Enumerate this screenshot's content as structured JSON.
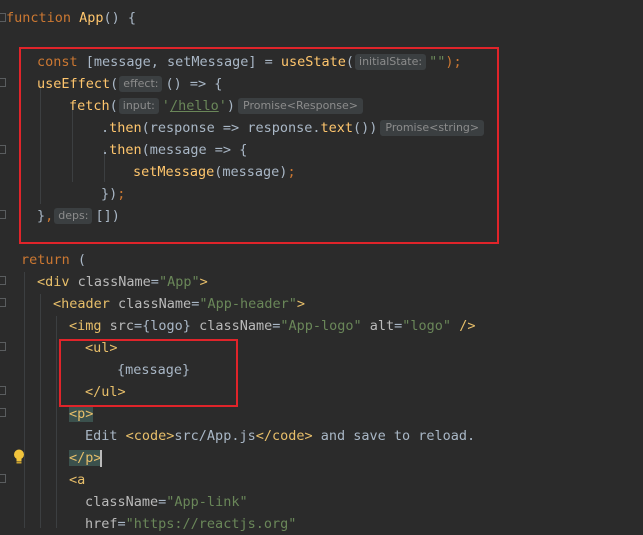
{
  "lines": {
    "l1": {
      "t1": "function",
      "t2": " App",
      "t3": "() {"
    },
    "l2": {
      "t1": "const",
      "t2": " [message, setMessage] = ",
      "t3": "useState",
      "t4": "(",
      "hint": "initialState:",
      "t5": "\"\"",
      "t6": ");"
    },
    "l3": {
      "t1": "useEffect",
      "t2": "(",
      "hint": "effect:",
      "t3": "() => {"
    },
    "l4": {
      "t1": "fetch",
      "t2": "(",
      "hint": "input:",
      "t3": "'",
      "t4": "/hello",
      "t5": "'",
      "t6": ")",
      "hint_after": "Promise<Response>"
    },
    "l5": {
      "t1": ".",
      "t2": "then",
      "t3": "(response => response.",
      "t4": "text",
      "t5": "()",
      "t6": ")",
      "hint_after": "Promise<string>"
    },
    "l6": {
      "t1": ".",
      "t2": "then",
      "t3": "(message => {"
    },
    "l7": {
      "t1": "setMessage",
      "t2": "(message)",
      "t3": ";"
    },
    "l8": {
      "t1": "})",
      "t2": ";"
    },
    "l9": {
      "t1": "}",
      "t2": ",",
      "hint": "deps:",
      "t3": "[])"
    },
    "l10": {
      "t1": "return",
      "t2": " ("
    },
    "l11": {
      "t1": "<div",
      "t2": " className",
      "t3": "=",
      "t4": "\"App\"",
      "t5": ">"
    },
    "l12": {
      "t1": "<header",
      "t2": " className",
      "t3": "=",
      "t4": "\"App-header\"",
      "t5": ">"
    },
    "l13": {
      "t1": "<img",
      "t2": " src",
      "t3": "={logo}",
      "t4": " className",
      "t5": "=",
      "t6": "\"App-logo\"",
      "t7": " alt",
      "t8": "=",
      "t9": "\"logo\"",
      "t10": " />"
    },
    "l14": {
      "t1": "<ul>"
    },
    "l15": {
      "t1": "{message}"
    },
    "l16": {
      "t1": "</ul>"
    },
    "l17": {
      "t1": "<p>"
    },
    "l18": {
      "t1": "Edit ",
      "t2": "<code>",
      "t3": "src/App.js",
      "t4": "</code>",
      "t5": " and save to reload."
    },
    "l19": {
      "t1": "</p>"
    },
    "l20": {
      "t1": "<a"
    },
    "l21": {
      "t1": "className",
      "t2": "=",
      "t3": "\"App-link\""
    },
    "l22": {
      "t1": "href",
      "t2": "=",
      "t3": "\"https://reactjs.org\""
    }
  },
  "colors": {
    "background": "#2b2b2b",
    "keyword": "#cc7832",
    "function": "#ffc66d",
    "string": "#6a8759",
    "tag": "#e8bf6a",
    "highlight_box": "#e0242a"
  },
  "icons": {
    "bulb": "lightbulb-icon"
  }
}
